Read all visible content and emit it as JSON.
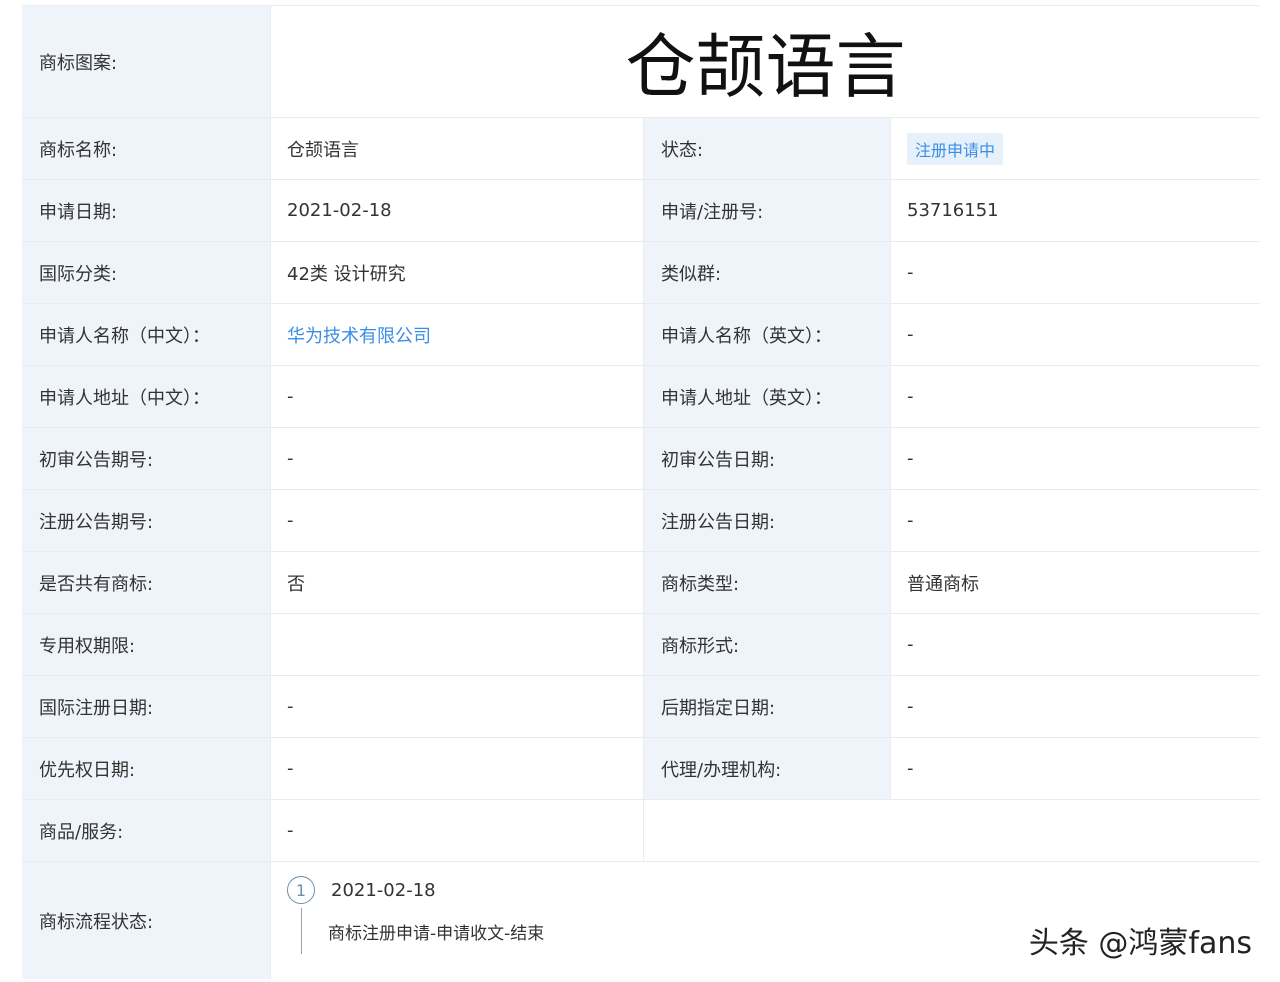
{
  "header": {
    "label": "商标图案:",
    "logo_text": "仓颉语言"
  },
  "rows": [
    {
      "l1": "商标名称:",
      "v1": "仓颉语言",
      "l2": "状态:",
      "v2": "注册申请中"
    },
    {
      "l1": "申请日期:",
      "v1": "2021-02-18",
      "l2": "申请/注册号:",
      "v2": "53716151"
    },
    {
      "l1": "国际分类:",
      "v1": "42类 设计研究",
      "l2": "类似群:",
      "v2": "-"
    },
    {
      "l1": "申请人名称（中文）：",
      "v1": "华为技术有限公司",
      "l2": "申请人名称（英文）：",
      "v2": "-"
    },
    {
      "l1": "申请人地址（中文）：",
      "v1": "-",
      "l2": "申请人地址（英文）：",
      "v2": "-"
    },
    {
      "l1": "初审公告期号:",
      "v1": "-",
      "l2": "初审公告日期:",
      "v2": "-"
    },
    {
      "l1": "注册公告期号:",
      "v1": "-",
      "l2": "注册公告日期:",
      "v2": "-"
    },
    {
      "l1": "是否共有商标:",
      "v1": "否",
      "l2": "商标类型:",
      "v2": "普通商标"
    },
    {
      "l1": "专用权期限:",
      "v1": "",
      "l2": "商标形式:",
      "v2": "-"
    },
    {
      "l1": "国际注册日期:",
      "v1": "-",
      "l2": "后期指定日期:",
      "v2": "-"
    },
    {
      "l1": "优先权日期:",
      "v1": "-",
      "l2": "代理/办理机构:",
      "v2": "-"
    }
  ],
  "goods": {
    "label": "商品/服务:",
    "value": "-"
  },
  "flow": {
    "label": "商标流程状态:",
    "step_number": "1",
    "date": "2021-02-18",
    "desc": "商标注册申请-申请收文-结束"
  },
  "watermark": "头条 @鸿蒙fans"
}
